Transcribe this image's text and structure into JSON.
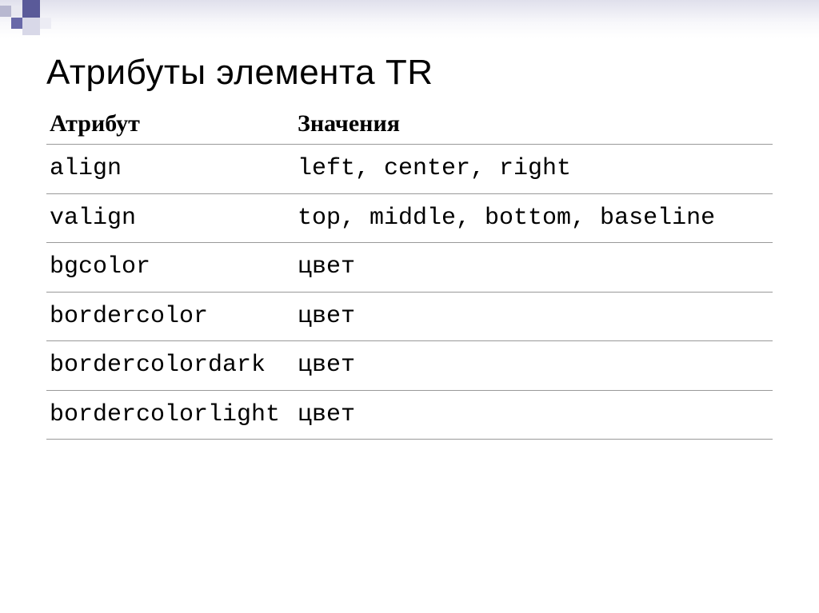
{
  "title": "Атрибуты элемента TR",
  "headers": {
    "attribute": "Атрибут",
    "values": "Значения"
  },
  "rows": [
    {
      "attr": "align",
      "val": "left, center, right"
    },
    {
      "attr": "valign",
      "val": "top, middle, bottom, baseline"
    },
    {
      "attr": "bgcolor",
      "val": "цвет"
    },
    {
      "attr": "bordercolor",
      "val": "цвет"
    },
    {
      "attr": "bordercolordark",
      "val": "цвет"
    },
    {
      "attr": "bordercolorlight",
      "val": "цвет"
    }
  ]
}
